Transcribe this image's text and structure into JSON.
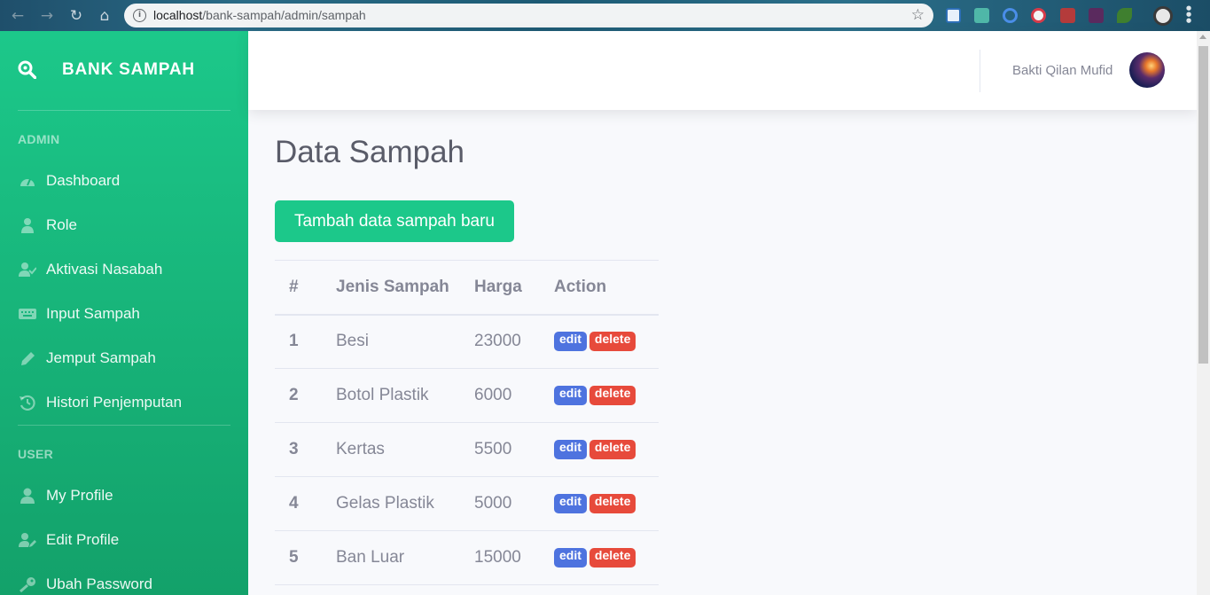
{
  "browser": {
    "url_host": "localhost",
    "url_path": "/bank-sampah/admin/sampah"
  },
  "sidebar": {
    "brand": "BANK SAMPAH",
    "sections": [
      {
        "heading": "ADMIN",
        "items": [
          {
            "label": "Dashboard",
            "icon": "tachometer-icon"
          },
          {
            "label": "Role",
            "icon": "user-tie-icon"
          },
          {
            "label": "Aktivasi Nasabah",
            "icon": "user-check-icon"
          },
          {
            "label": "Input Sampah",
            "icon": "keyboard-icon"
          },
          {
            "label": "Jemput Sampah",
            "icon": "pen-icon"
          },
          {
            "label": "Histori Penjemputan",
            "icon": "history-icon"
          }
        ]
      },
      {
        "heading": "USER",
        "items": [
          {
            "label": "My Profile",
            "icon": "user-icon"
          },
          {
            "label": "Edit Profile",
            "icon": "user-edit-icon"
          },
          {
            "label": "Ubah Password",
            "icon": "key-icon"
          }
        ]
      }
    ]
  },
  "topbar": {
    "user_name": "Bakti Qilan Mufid"
  },
  "main": {
    "title": "Data Sampah",
    "add_button": "Tambah data sampah baru",
    "table": {
      "columns": [
        "#",
        "Jenis Sampah",
        "Harga",
        "Action"
      ],
      "rows": [
        {
          "no": "1",
          "jenis": "Besi",
          "harga": "23000"
        },
        {
          "no": "2",
          "jenis": "Botol Plastik",
          "harga": "6000"
        },
        {
          "no": "3",
          "jenis": "Kertas",
          "harga": "5500"
        },
        {
          "no": "4",
          "jenis": "Gelas Plastik",
          "harga": "5000"
        },
        {
          "no": "5",
          "jenis": "Ban Luar",
          "harga": "15000"
        }
      ],
      "edit_label": "edit",
      "delete_label": "delete"
    }
  },
  "colors": {
    "sidebar_accent": "#1cc88a",
    "edit_badge": "#4e73df",
    "delete_badge": "#e74a3b"
  }
}
